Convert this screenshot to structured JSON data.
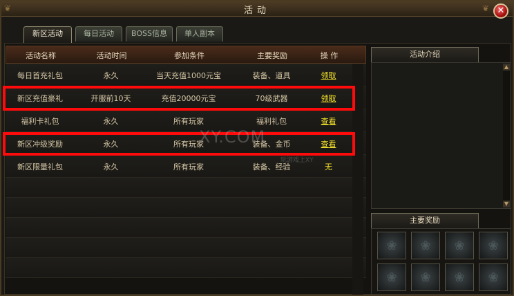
{
  "window": {
    "title": "活动",
    "close_symbol": "✕"
  },
  "tabs": [
    {
      "label": "新区活动",
      "active": true
    },
    {
      "label": "每日活动",
      "active": false
    },
    {
      "label": "BOSS信息",
      "active": false
    },
    {
      "label": "单人副本",
      "active": false
    }
  ],
  "table": {
    "headers": [
      "活动名称",
      "活动时间",
      "参加条件",
      "主要奖励",
      "操  作"
    ],
    "rows": [
      {
        "name": "每日首充礼包",
        "time": "永久",
        "condition": "当天充值1000元宝",
        "reward": "装备、道具",
        "action": "领取",
        "highlighted": false
      },
      {
        "name": "新区充值豪礼",
        "time": "开服前10天",
        "condition": "充值20000元宝",
        "reward": "70级武器",
        "action": "领取",
        "highlighted": true
      },
      {
        "name": "福利卡礼包",
        "time": "永久",
        "condition": "所有玩家",
        "reward": "福利礼包",
        "action": "查看",
        "highlighted": false
      },
      {
        "name": "新区冲级奖励",
        "time": "永久",
        "condition": "所有玩家",
        "reward": "装备、金币",
        "action": "查看",
        "highlighted": true
      },
      {
        "name": "新区限量礼包",
        "time": "永久",
        "condition": "所有玩家",
        "reward": "装备、经验",
        "action": "无",
        "highlighted": false
      }
    ]
  },
  "right_panel": {
    "intro_tab": "活动介绍",
    "reward_tab": "主要奖励",
    "scroll_up": "▲",
    "scroll_down": "▼"
  },
  "watermark": {
    "main": "XY.COM",
    "sub": "玩游戏上XY"
  },
  "colors": {
    "highlight": "#ff0b0b",
    "link": "#f2e22a",
    "header_bg": "#4a2b1a"
  }
}
